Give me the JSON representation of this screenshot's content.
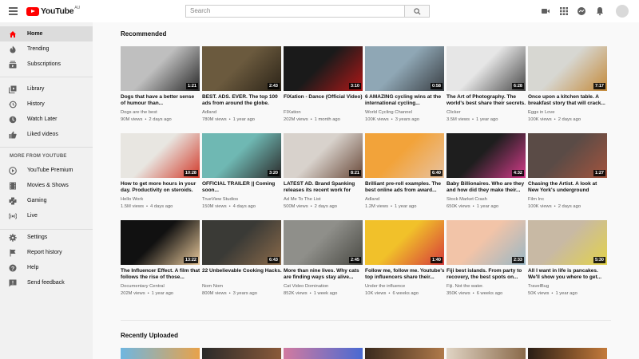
{
  "header": {
    "logo_text": "YouTube",
    "logo_region": "AU",
    "search_placeholder": "Search"
  },
  "colors": {
    "accent": "#ff0000",
    "sidebar_bg": "#f1f1f1",
    "active_bg": "#dcdcdc",
    "page_bg": "#f9f9f9"
  },
  "sidebar": {
    "primary": [
      {
        "label": "Home",
        "icon": "home-icon"
      },
      {
        "label": "Trending",
        "icon": "flame-icon"
      },
      {
        "label": "Subscriptions",
        "icon": "subscriptions-icon"
      }
    ],
    "library": [
      {
        "label": "Library",
        "icon": "library-icon"
      },
      {
        "label": "History",
        "icon": "history-icon"
      },
      {
        "label": "Watch Later",
        "icon": "clock-icon"
      },
      {
        "label": "Liked videos",
        "icon": "thumbs-up-icon"
      }
    ],
    "more_heading": "MORE FROM YOUTUBE",
    "more": [
      {
        "label": "YouTube Premium",
        "icon": "premium-icon"
      },
      {
        "label": "Movies & Shows",
        "icon": "film-icon"
      },
      {
        "label": "Gaming",
        "icon": "gaming-icon"
      },
      {
        "label": "Live",
        "icon": "live-icon"
      }
    ],
    "settings": [
      {
        "label": "Settings",
        "icon": "gear-icon"
      },
      {
        "label": "Report history",
        "icon": "flag-icon"
      },
      {
        "label": "Help",
        "icon": "help-icon"
      },
      {
        "label": "Send feedback",
        "icon": "feedback-icon"
      }
    ]
  },
  "recommended": {
    "title": "Recommended",
    "videos": [
      {
        "title": "Dogs that have a better sense of humour than...",
        "channel": "Dogs are the best",
        "views": "90M views",
        "age": "2 days ago",
        "duration": "1:21",
        "thumb_colors": [
          "#bfbfbf",
          "#2a2a2a"
        ]
      },
      {
        "title": "BEST. ADS. EVER. The top 100 ads from around the globe.",
        "channel": "Adland",
        "views": "780M views",
        "age": "1 year ago",
        "duration": "2:43",
        "thumb_colors": [
          "#6b5a3e",
          "#2c2418"
        ]
      },
      {
        "title": "FIXation - Dance (Official Video)",
        "channel": "FIXation",
        "views": "202M views",
        "age": "1 month ago",
        "duration": "3:10",
        "thumb_colors": [
          "#1a1a1a",
          "#b01818"
        ]
      },
      {
        "title": "6 AMAZING cycling wins at the international cycling...",
        "channel": "World Cycling Channel",
        "views": "100K views",
        "age": "3 years ago",
        "duration": "0:58",
        "thumb_colors": [
          "#8fa7b5",
          "#3a3f44"
        ]
      },
      {
        "title": "The Art of Photography. The world's best share their secrets.",
        "channel": "Clicker",
        "views": "3.5M views",
        "age": "1 year ago",
        "duration": "6:28",
        "thumb_colors": [
          "#e6e6e6",
          "#4a4a4a"
        ]
      },
      {
        "title": "Once upon a kitchen table. A breakfast story that will crack...",
        "channel": "Eggs in Love",
        "views": "100K views",
        "age": "2 days ago",
        "duration": "7:17",
        "thumb_colors": [
          "#d7d7d2",
          "#c48a3a"
        ]
      }
    ],
    "videos2": [
      {
        "title": "How to get more hours in your day. Productivity on steroids.",
        "channel": "Hello Work",
        "views": "1.5M views",
        "age": "4 days ago",
        "duration": "10:28",
        "thumb_colors": [
          "#e8e6e1",
          "#d23a2a"
        ]
      },
      {
        "title": "OFFICIAL TRAILER || Coming soon...",
        "channel": "TrueView Studios",
        "views": "150M views",
        "age": "4 days ago",
        "duration": "3:20",
        "thumb_colors": [
          "#6fb8b3",
          "#2b2b2b"
        ]
      },
      {
        "title": "LATEST AD. Brand Spanking releases its recent work for the...",
        "channel": "Ad Me To The List",
        "views": "500M views",
        "age": "2 days ago",
        "duration": "8:21",
        "thumb_colors": [
          "#d8d2cc",
          "#6a4a3a"
        ]
      },
      {
        "title": "Brilliant pre-roll examples. The best online ads from award...",
        "channel": "Adland",
        "views": "1.2M views",
        "age": "1 year ago",
        "duration": "6:40",
        "thumb_colors": [
          "#f2a33a",
          "#e8c2a0"
        ]
      },
      {
        "title": "Baby Billionaires. Who are they and how did they make their...",
        "channel": "Stock Market Crash",
        "views": "650K views",
        "age": "1 year ago",
        "duration": "4:32",
        "thumb_colors": [
          "#1e1e1e",
          "#d43b8a"
        ]
      },
      {
        "title": "Chasing the Artist. A look at New York's underground graffiti...",
        "channel": "Film Inc",
        "views": "100K views",
        "age": "2 days ago",
        "duration": "1:27",
        "thumb_colors": [
          "#5a4b46",
          "#a3543e"
        ]
      }
    ],
    "videos3": [
      {
        "title": "The Influencer Effect. A film that follows the rise of those...",
        "channel": "Documentary Central",
        "views": "202M views",
        "age": "1 year ago",
        "duration": "13:22",
        "thumb_colors": [
          "#111111",
          "#e8c89a"
        ]
      },
      {
        "title": "22 Unbelievable Cooking Hacks.",
        "channel": "Nom Nom",
        "views": "800M views",
        "age": "3 years ago",
        "duration": "6:43",
        "thumb_colors": [
          "#3a3a36",
          "#8a6a4a"
        ]
      },
      {
        "title": "More than nine lives. Why cats are finding ways stay alive...",
        "channel": "Cat Video Domination",
        "views": "852K views",
        "age": "1 week ago",
        "duration": "2:45",
        "thumb_colors": [
          "#8f8f8a",
          "#4a4a44"
        ]
      },
      {
        "title": "Follow me, follow me. Youtube's top influencers share their...",
        "channel": "Under the influence",
        "views": "10K views",
        "age": "6 weeks ago",
        "duration": "1:40",
        "thumb_colors": [
          "#f1c12a",
          "#d63a3a"
        ]
      },
      {
        "title": "Fiji best islands. From party to recovery, the best spots on...",
        "channel": "Fiji. Not the water.",
        "views": "350K views",
        "age": "6 weeks ago",
        "duration": "2:33",
        "thumb_colors": [
          "#f2c4a8",
          "#9ab7c4"
        ]
      },
      {
        "title": "All I want in life is pancakes. We'll show you where to get...",
        "channel": "TravelBug",
        "views": "50K views",
        "age": "1 year ago",
        "duration": "5:30",
        "thumb_colors": [
          "#c8b9a4",
          "#e2d24a"
        ]
      }
    ]
  },
  "recent": {
    "title": "Recently Uploaded",
    "thumb_colors": [
      [
        "#6fb6e0",
        "#e8a24a"
      ],
      [
        "#2a2a2a",
        "#8a5a3a"
      ],
      [
        "#d27aa0",
        "#4a6ad2"
      ],
      [
        "#3a2a1e",
        "#b07a4a"
      ],
      [
        "#e0d4c4",
        "#8a6a4a"
      ],
      [
        "#2a1e16",
        "#c47a3a"
      ]
    ]
  }
}
